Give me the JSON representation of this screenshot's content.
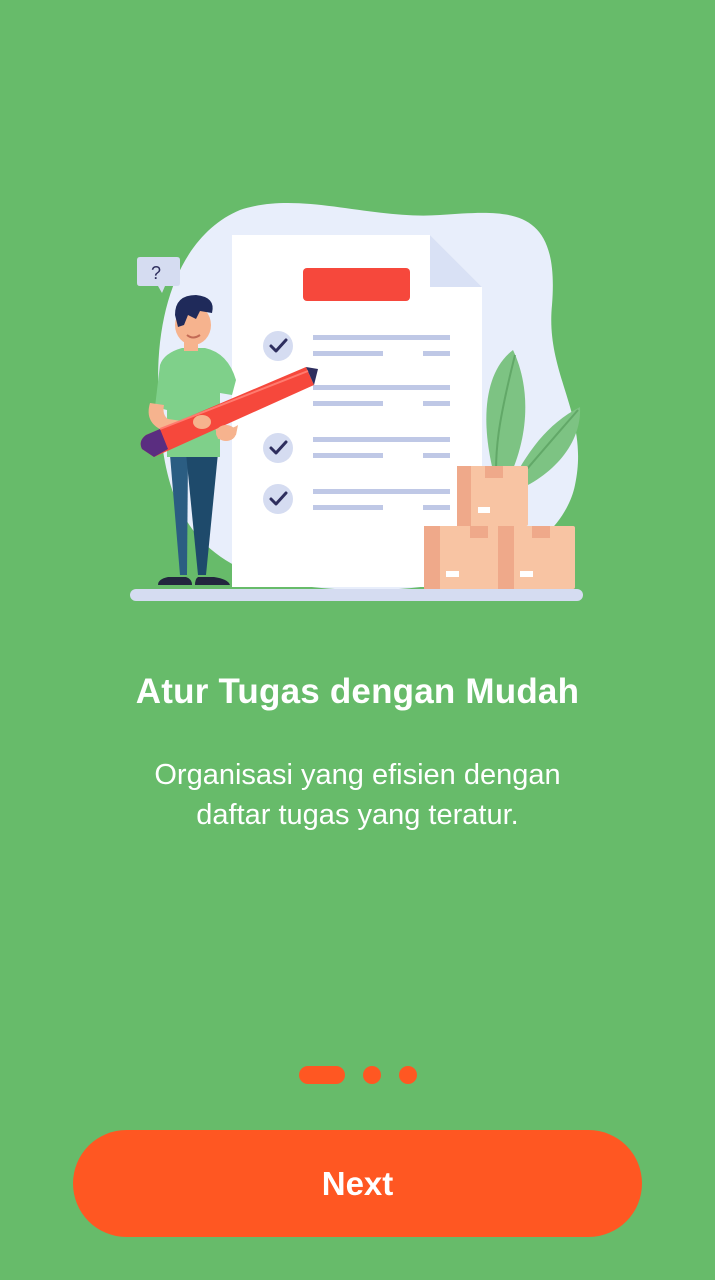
{
  "onboarding": {
    "title": "Atur Tugas dengan Mudah",
    "subtitle_line1": "Organisasi yang efisien dengan",
    "subtitle_line2": "daftar tugas yang teratur.",
    "question_mark": "?",
    "page_indicator": {
      "total_pages": 3,
      "current_page": 1
    },
    "next_label": "Next"
  },
  "colors": {
    "background": "#67BB6A",
    "accent": "#FF5722",
    "text": "#FFFFFF"
  },
  "icons": [
    "question-bubble-icon",
    "checkmark-icon",
    "pencil-icon",
    "box-icon",
    "leaf-icon"
  ]
}
